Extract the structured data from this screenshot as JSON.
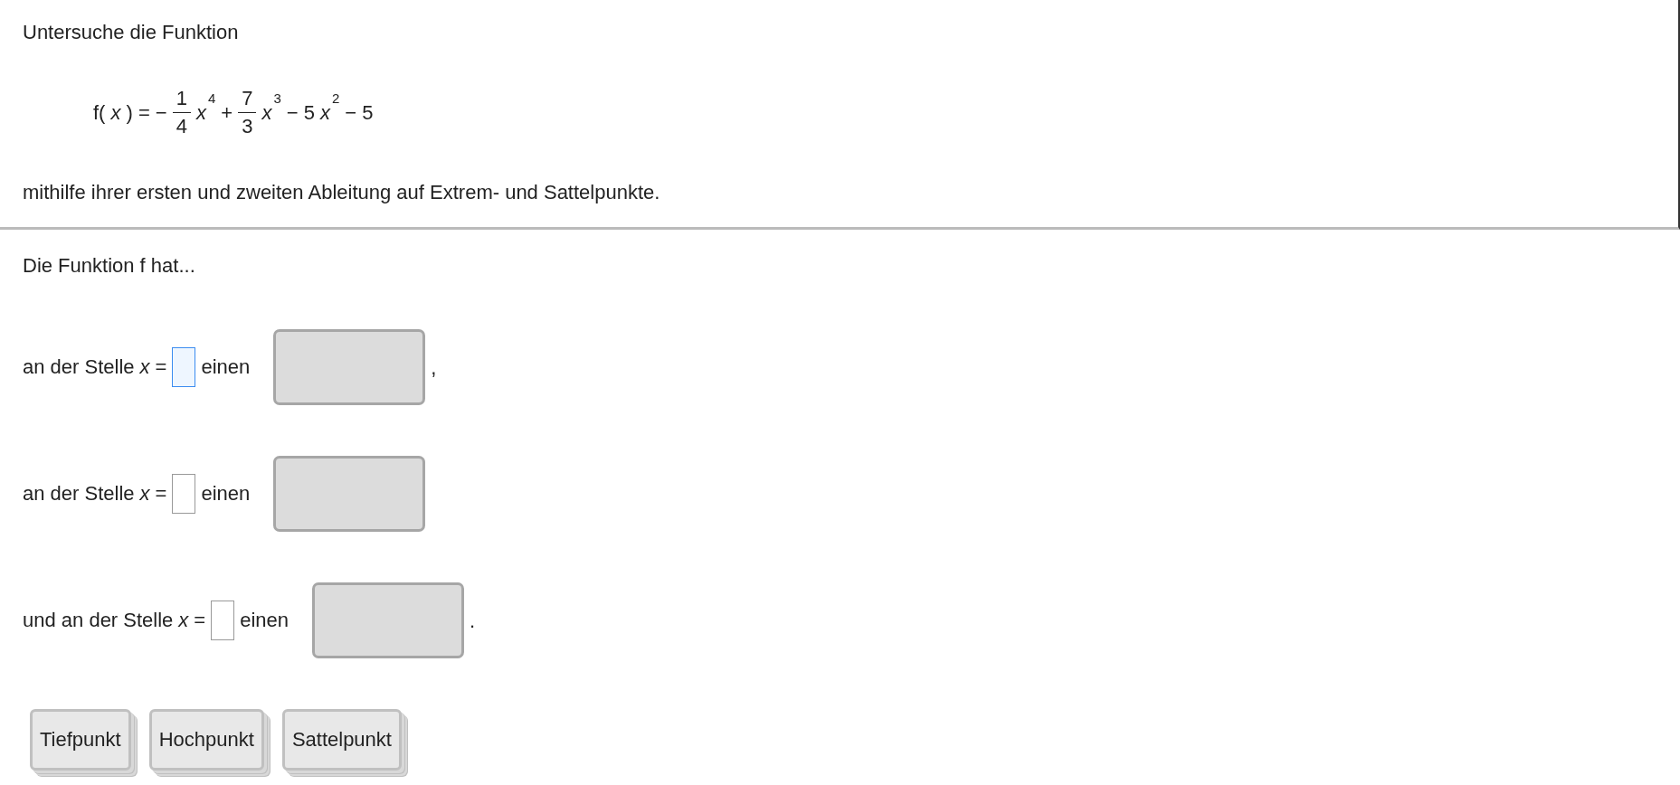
{
  "intro": "Untersuche die Funktion",
  "formula": [
    {
      "kind": "text",
      "text": "f("
    },
    {
      "kind": "var",
      "text": "x"
    },
    {
      "kind": "text",
      "text": ") = −"
    },
    {
      "kind": "fraction",
      "numerator": "1",
      "denominator": "4"
    },
    {
      "kind": "power",
      "base": "x",
      "exponent": "4"
    },
    {
      "kind": "text",
      "text": "+"
    },
    {
      "kind": "fraction",
      "numerator": "7",
      "denominator": "3"
    },
    {
      "kind": "power",
      "base": "x",
      "exponent": "3"
    },
    {
      "kind": "text",
      "text": "− 5"
    },
    {
      "kind": "power",
      "base": "x",
      "exponent": "2"
    },
    {
      "kind": "text",
      "text": "− 5"
    }
  ],
  "task": "mithilfe ihrer ersten und zweiten Ableitung auf Extrem- und Sattelpunkte.",
  "lead": "Die Funktion f hat...",
  "rows": [
    {
      "prefix": "an der Stelle",
      "variable": "x",
      "equals": "=",
      "focused": true,
      "middle": "einen",
      "punctuation": ","
    },
    {
      "prefix": "an der Stelle",
      "variable": "x",
      "equals": "=",
      "focused": false,
      "middle": "einen"
    },
    {
      "prefix": "und an der Stelle",
      "variable": "x",
      "equals": "=",
      "focused": false,
      "middle": "einen",
      "punctuation": "."
    }
  ],
  "choices": [
    "Tiefpunkt",
    "Hochpunkt",
    "Sattelpunkt"
  ]
}
